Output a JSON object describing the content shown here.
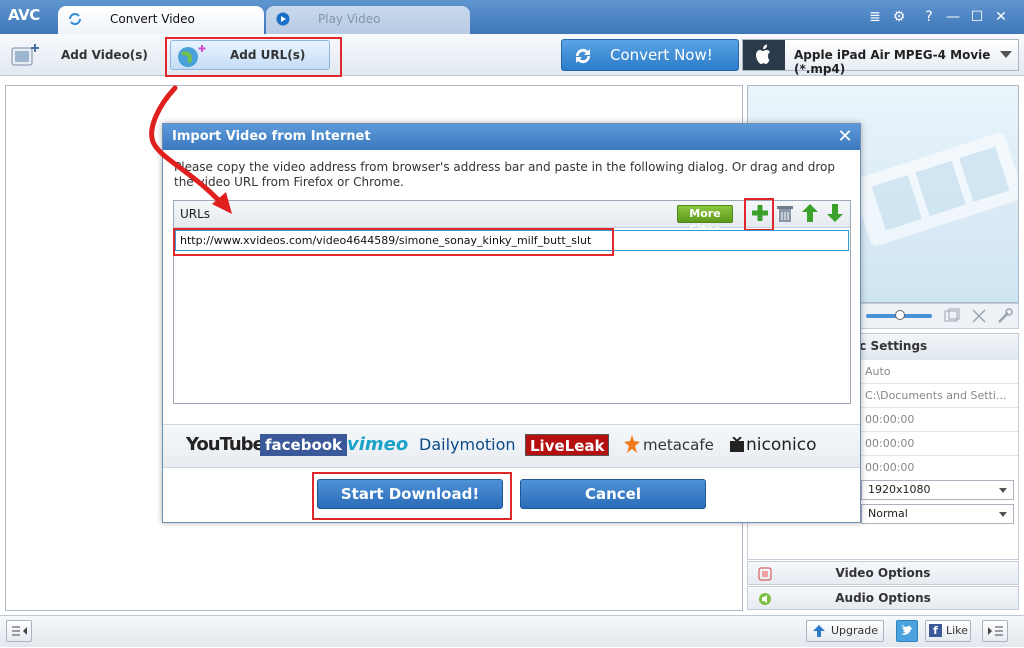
{
  "app": {
    "logo": "AVC"
  },
  "tabs": [
    {
      "label": "Convert Video"
    },
    {
      "label": "Play Video"
    }
  ],
  "window_controls": [
    "≣",
    "⚙",
    "?",
    "—",
    "☐",
    "✕"
  ],
  "toolbar": {
    "add_videos": "Add Video(s)",
    "add_urls": "Add URL(s)",
    "convert_now": "Convert Now!",
    "profile": "Apple iPad Air MPEG-4 Movie (*.mp4)"
  },
  "settings": {
    "header": "sic Settings",
    "rows": [
      "Auto",
      "C:\\Documents and Setti...",
      "00:00:00",
      "00:00:00",
      "00:00:00"
    ],
    "resolution": "1920x1080",
    "quality": "Normal"
  },
  "options": {
    "video": "Video Options",
    "audio": "Audio Options"
  },
  "statusbar": {
    "upgrade": "Upgrade",
    "like": "Like"
  },
  "dialog": {
    "title": "Import Video from Internet",
    "message": "Please copy the video address from browser's address bar and paste in the following dialog. Or drag and drop the video URL from Firefox or Chrome.",
    "urls_label": "URLs",
    "more_sites": "More Sites",
    "url": "http://www.xvideos.com/video4644589/simone_sonay_kinky_milf_butt_slut",
    "sites": [
      "YouTube",
      "facebook",
      "vimeo",
      "Dailymotion",
      "LiveLeak",
      "metacafe",
      "niconico"
    ],
    "start_download": "Start Download!",
    "cancel": "Cancel"
  },
  "colors": {
    "accent": "#3b78bf",
    "highlight": "#e0282c",
    "green": "#5c9a1d"
  }
}
